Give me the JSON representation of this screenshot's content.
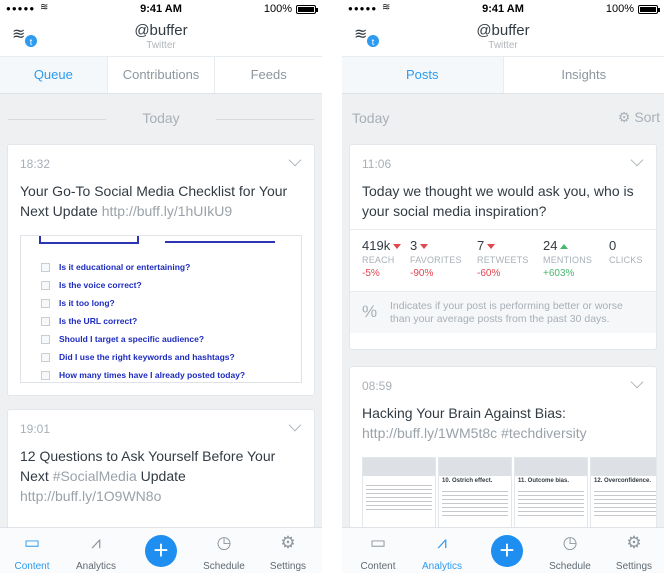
{
  "status": {
    "time": "9:41 AM",
    "battery": "100%",
    "signal": "●●●●●",
    "wifi": "wifi"
  },
  "left": {
    "nav": {
      "title": "@buffer",
      "subtitle": "Twitter"
    },
    "tabs": [
      "Queue",
      "Contributions",
      "Feeds"
    ],
    "day_label": "Today",
    "posts": [
      {
        "time": "18:32",
        "text": "Your Go-To Social Media Checklist for Your Next Update ",
        "link": "http://buff.ly/1hUIkU9",
        "checklist": [
          "Is it educational or entertaining?",
          "Is the voice correct?",
          "Is it too long?",
          "Is the URL correct?",
          "Should I target a specific audience?",
          "Did I use the right keywords and hashtags?",
          "How many times have I already posted today?"
        ]
      },
      {
        "time": "19:01",
        "text_a": "12 Questions to Ask Yourself Before Your Next ",
        "hashtag": "#SocialMedia",
        "text_b": " Update ",
        "link": "http://buff.ly/1O9WN8o"
      }
    ],
    "tabbar": [
      "Content",
      "Analytics",
      "Schedule",
      "Settings"
    ]
  },
  "right": {
    "nav": {
      "title": "@buffer",
      "subtitle": "Twitter"
    },
    "tabs": [
      "Posts",
      "Insights"
    ],
    "day_label": "Today",
    "sort_label": "Sort",
    "posts": [
      {
        "time": "11:06",
        "text": "Today we thought we would ask you, who is your social media inspiration?",
        "stats": [
          {
            "value": "419k",
            "label": "REACH",
            "change": "-5%",
            "trend": "down"
          },
          {
            "value": "3",
            "label": "FAVORITES",
            "change": "-90%",
            "trend": "down"
          },
          {
            "value": "7",
            "label": "RETWEETS",
            "change": "-60%",
            "trend": "down"
          },
          {
            "value": "24",
            "label": "MENTIONS",
            "change": "+603%",
            "trend": "up"
          },
          {
            "value": "0",
            "label": "CLICKS",
            "change": "",
            "trend": "none"
          }
        ],
        "note": "Indicates if your post is performing better or worse than your average posts from the past 30 days."
      },
      {
        "time": "08:59",
        "text": "Hacking Your Brain Against Bias: ",
        "link": "http://buff.ly/1WM5t8c",
        "hashtag": " #techdiversity",
        "thumbs": [
          "",
          "10. Ostrich effect.",
          "11. Outcome bias.",
          "12. Overconfidence."
        ]
      }
    ],
    "tabbar": [
      "Content",
      "Analytics",
      "Schedule",
      "Settings"
    ]
  },
  "colors": {
    "accent": "#2c9bf0",
    "down": "#e0464e",
    "up": "#48b870"
  }
}
